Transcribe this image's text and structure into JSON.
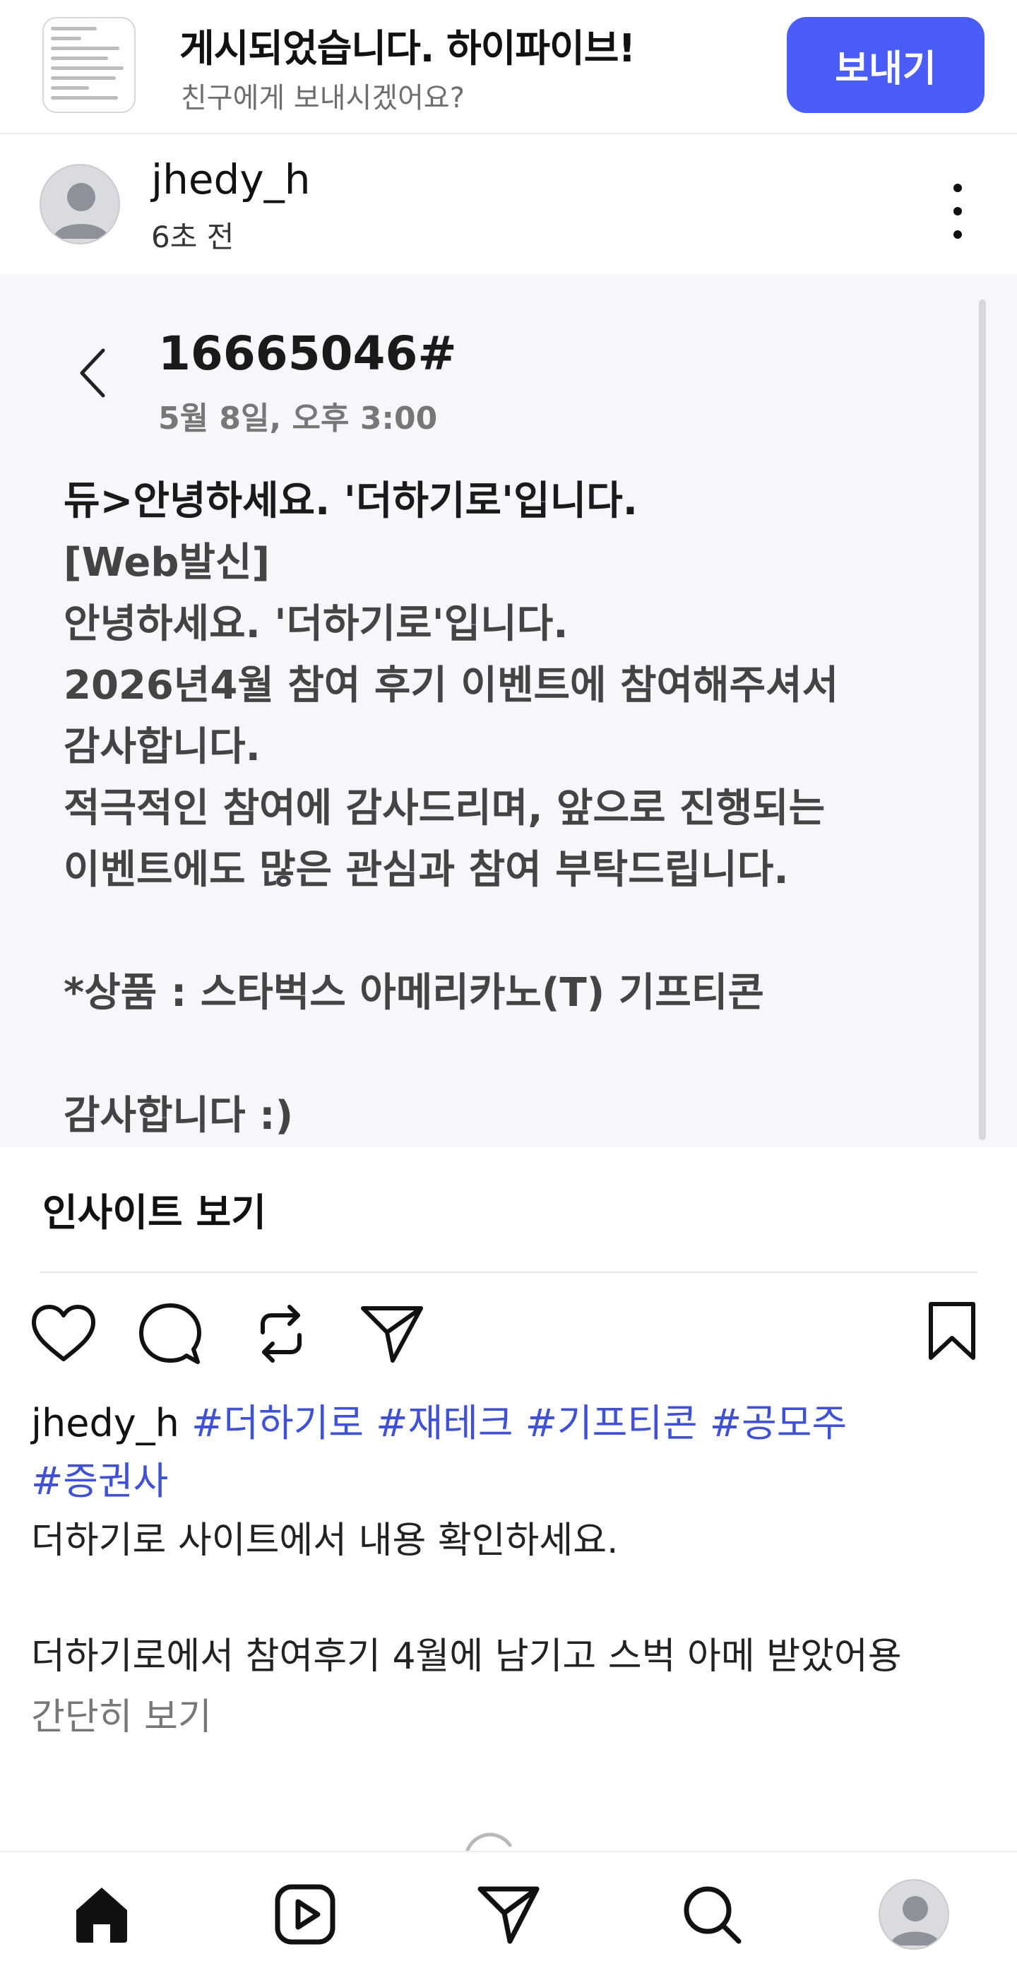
{
  "banner": {
    "title": "게시되었습니다. 하이파이브!",
    "subtitle": "친구에게 보내시겠어요?",
    "send_label": "보내기"
  },
  "post": {
    "username": "jhedy_h",
    "time_ago": "6초 전"
  },
  "screenshot": {
    "title": "16665046#",
    "date": "5월 8일, 오후 3:00",
    "lines": [
      "듀>안녕하세요. '더하기로'입니다.",
      "[Web발신]",
      "안녕하세요. '더하기로'입니다.",
      "2026년4월 참여 후기 이벤트에 참여해주셔서",
      "감사합니다.",
      "적극적인 참여에 감사드리며, 앞으로 진행되는",
      "이벤트에도 많은 관심과 참여 부탁드립니다.",
      "",
      "*상품 : 스타벅스 아메리카노(T) 기프티콘",
      "",
      "감사합니다 :)"
    ]
  },
  "insights": {
    "label": "인사이트 보기"
  },
  "actions": {
    "icons": [
      "heart-icon",
      "comment-icon",
      "repost-icon",
      "share-icon",
      "bookmark-icon"
    ]
  },
  "caption": {
    "username": "jhedy_h",
    "tags": [
      "#더하기로",
      "#재테크",
      "#기프티콘",
      "#공모주",
      "#증권사"
    ],
    "line1": "더하기로 사이트에서 내용 확인하세요.",
    "line2": "더하기로에서 참여후기 4월에 남기고 스벅 아메 받았어용",
    "see_less": "간단히 보기"
  },
  "nav": {
    "icons": [
      "home-icon",
      "reels-icon",
      "direct-icon",
      "search-icon",
      "profile-avatar"
    ]
  },
  "colors": {
    "accent": "#4a5df9",
    "hashtag": "#3f51d9",
    "muted": "#777777"
  }
}
